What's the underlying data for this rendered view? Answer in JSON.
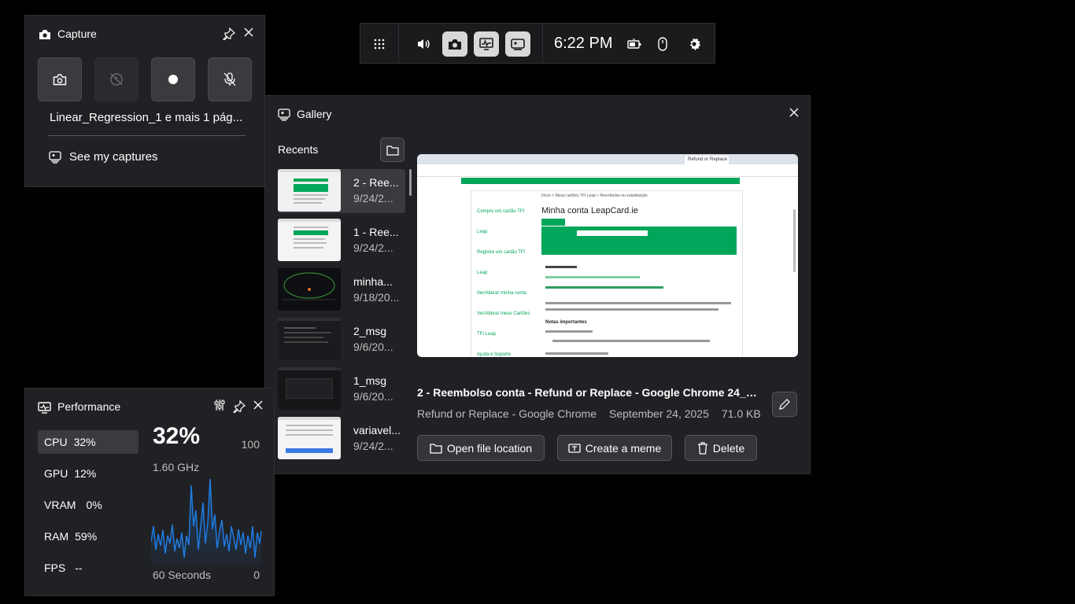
{
  "topbar": {
    "time": "6:22 PM"
  },
  "capture": {
    "title": "Capture",
    "recent_capture_name": "Linear_Regression_1 e mais 1 pág...",
    "see_my_captures": "See my captures"
  },
  "gallery": {
    "title": "Gallery",
    "recents_label": "Recents",
    "items": [
      {
        "name": "2 - Ree...",
        "date": "9/24/2..."
      },
      {
        "name": "1 - Ree...",
        "date": "9/24/2..."
      },
      {
        "name": "minha...",
        "date": "9/18/20..."
      },
      {
        "name": "2_msg",
        "date": "9/6/20..."
      },
      {
        "name": "1_msg",
        "date": "9/6/20..."
      },
      {
        "name": "variavel...",
        "date": "9/24/2..."
      }
    ],
    "selected": {
      "title": "2 - Reembolso conta - Refund or Replace - Google Chrome 24_0...",
      "app": "Refund or Replace - Google Chrome",
      "date": "September 24, 2025",
      "size": "71.0 KB"
    },
    "buttons": {
      "open_location": "Open file location",
      "create_meme": "Create a meme",
      "delete": "Delete"
    },
    "preview": {
      "tab_active": "Refund or Replace",
      "site_title": "Minha conta LeapCard.ie",
      "breadcrumb": "Início > Meus cartões TFI Leap > Reembolso ou substituição",
      "side_links": [
        "Compre um cartão TFI Leap",
        "Registre um cartão TFI Leap",
        "Ver/Alterar minha conta",
        "Ver/Alterar meus Cartões TFI Leap",
        "Ajuda e Suporte"
      ],
      "section": "Notas importantes"
    }
  },
  "performance": {
    "title": "Performance",
    "metrics": [
      {
        "label": "CPU",
        "value": "32%"
      },
      {
        "label": "GPU",
        "value": "12%"
      },
      {
        "label": "VRAM",
        "value": "0%"
      },
      {
        "label": "RAM",
        "value": "59%"
      },
      {
        "label": "FPS",
        "value": "--"
      }
    ],
    "big_value": "32%",
    "max_label": "100",
    "frequency": "1.60 GHz",
    "x_label": "60 Seconds",
    "min_label": "0",
    "accent": "#1f7ae0"
  }
}
